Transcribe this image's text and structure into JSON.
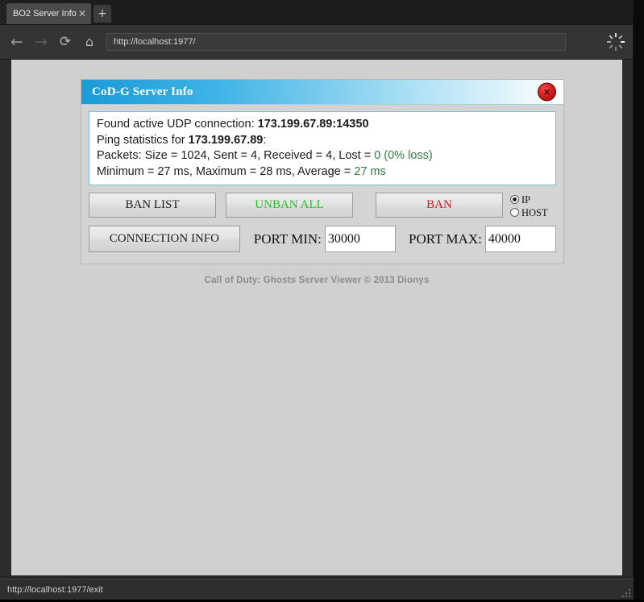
{
  "window": {
    "close_label": "✕"
  },
  "browser": {
    "tab": {
      "title": "BO2 Server Info",
      "close_glyph": "✕"
    },
    "new_tab_glyph": "+",
    "nav": {
      "back_glyph": "←",
      "forward_glyph": "→",
      "reload_glyph": "⟳",
      "home_glyph": "⌂"
    },
    "url": "http://localhost:1977/",
    "status_text": "http://localhost:1977/exit"
  },
  "app": {
    "title": "CoD-G Server Info",
    "close_glyph": "✕",
    "info": {
      "line1_prefix": "Found active UDP connection: ",
      "line1_value": "173.199.67.89:14350",
      "line2_prefix": "Ping statistics for ",
      "line2_value": "173.199.67.89",
      "line2_suffix": ":",
      "line3_prefix": "Packets: Size = 1024, Sent = 4, Received = 4, Lost = ",
      "line3_value": "0 (0% loss)",
      "line4_prefix": "Minimum = 27 ms, Maximum = 28 ms, Average = ",
      "line4_value": "27 ms"
    },
    "buttons": {
      "ban_list": "BAN LIST",
      "unban_all": "UNBAN ALL",
      "ban": "BAN",
      "connection_info": "CONNECTION INFO"
    },
    "radios": {
      "ip_label": "IP",
      "host_label": "HOST",
      "selected": "IP"
    },
    "ports": {
      "min_label": "PORT MIN:",
      "min_value": "30000",
      "max_label": "PORT MAX:",
      "max_value": "40000"
    },
    "footer": "Call of Duty: Ghosts Server Viewer © 2013 Dionys",
    "colors": {
      "title_blue": "#1a9bd7",
      "green": "#1fc21f",
      "red": "#cc1f1f",
      "stat_green": "#2f7d3b"
    }
  }
}
